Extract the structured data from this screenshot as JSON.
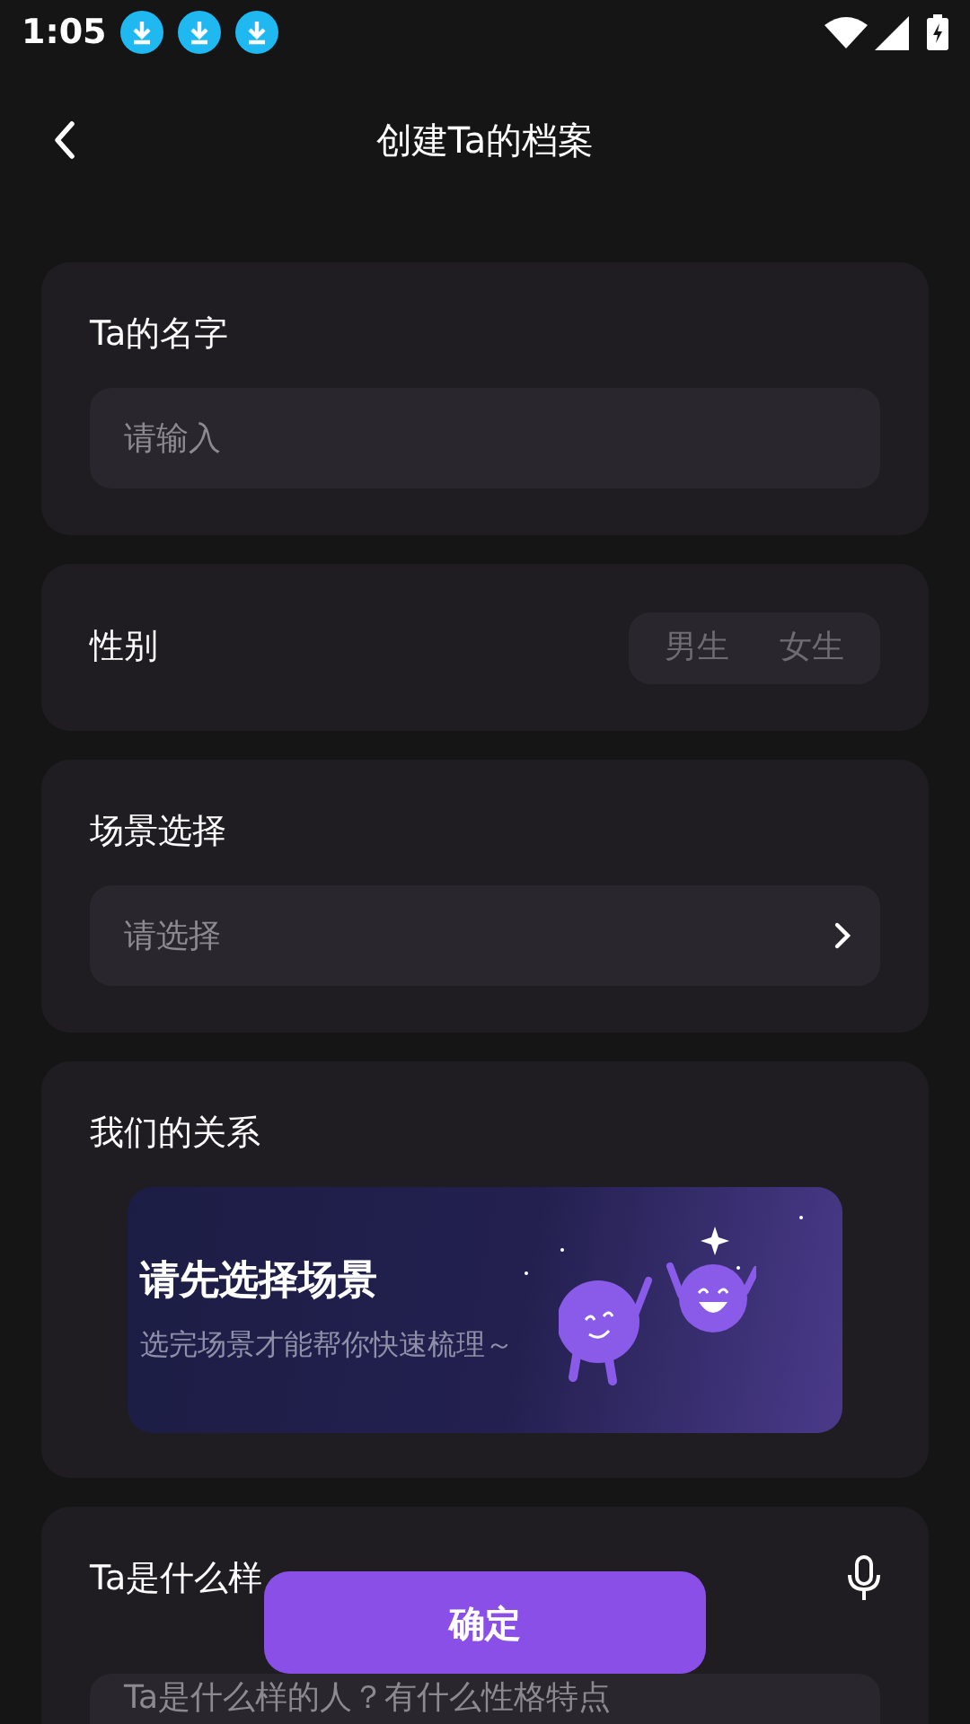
{
  "status_bar": {
    "time": "1:05",
    "notifications": [
      {
        "kind": "download"
      },
      {
        "kind": "download"
      },
      {
        "kind": "download"
      }
    ]
  },
  "header": {
    "title": "创建Ta的档案"
  },
  "name_field": {
    "label": "Ta的名字",
    "placeholder": "请输入"
  },
  "gender": {
    "label": "性别",
    "options": [
      {
        "label": "男生",
        "selected": false
      },
      {
        "label": "女生",
        "selected": false
      }
    ]
  },
  "scene": {
    "label": "场景选择",
    "placeholder": "请选择"
  },
  "relationship": {
    "label": "我们的关系",
    "banner_title": "请先选择场景",
    "banner_subtitle": "选完场景才能帮你快速梳理～"
  },
  "description": {
    "label": "Ta是什么样",
    "placeholder": "Ta是什么样的人？有什么性格特点"
  },
  "confirm_button": "确定"
}
